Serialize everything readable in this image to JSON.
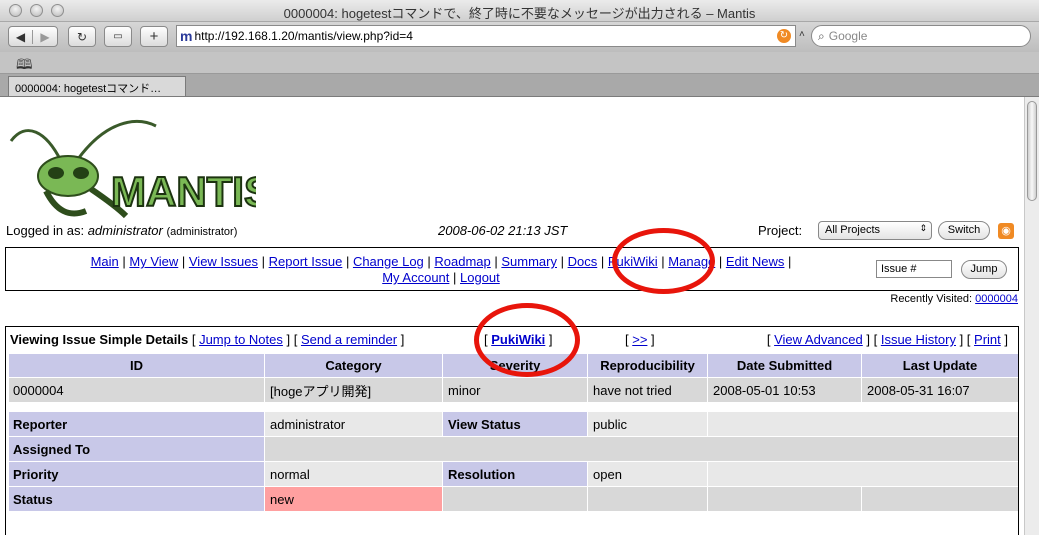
{
  "window": {
    "title": "0000004: hogetestコマンドで、終了時に不要なメッセージが出力される – Mantis",
    "url": "http://192.168.1.20/mantis/view.php?id=4",
    "search_placeholder": "Google",
    "tab_title": "0000004: hogetestコマンド…"
  },
  "header": {
    "logo_text": "MANTIS",
    "logged_in_label": "Logged in as:",
    "user": "administrator",
    "user_role": "(administrator)",
    "datetime": "2008-06-02 21:13 JST",
    "project_label": "Project:",
    "project_value": "All Projects",
    "switch_label": "Switch"
  },
  "menu": {
    "items": [
      "Main",
      "My View",
      "View Issues",
      "Report Issue",
      "Change Log",
      "Roadmap",
      "Summary",
      "Docs",
      "PukiWiki",
      "Manage",
      "Edit News",
      "My Account",
      "Logout"
    ],
    "issue_placeholder": "Issue #",
    "jump_label": "Jump"
  },
  "recent": {
    "label": "Recently Visited:",
    "issue": "0000004"
  },
  "details": {
    "title": "Viewing Issue Simple Details",
    "links": [
      "Jump to Notes",
      "Send a reminder",
      "PukiWiki",
      ">>",
      "View Advanced",
      "Issue History",
      "Print"
    ],
    "headers": [
      "ID",
      "Category",
      "Severity",
      "Reproducibility",
      "Date Submitted",
      "Last Update"
    ],
    "values": [
      "0000004",
      "[hogeアプリ開発]",
      "minor",
      "have not tried",
      "2008-05-01 10:53",
      "2008-05-31 16:07"
    ],
    "reporter_label": "Reporter",
    "reporter": "administrator",
    "view_status_label": "View Status",
    "view_status": "public",
    "assigned_label": "Assigned To",
    "priority_label": "Priority",
    "priority": "normal",
    "resolution_label": "Resolution",
    "resolution": "open",
    "status_label": "Status",
    "status": "new"
  },
  "colors": {
    "link": "#0000cc",
    "header_bg": "#c8c8e8",
    "status_new": "#ffa0a0",
    "annotation_circle": "#e8150b"
  }
}
